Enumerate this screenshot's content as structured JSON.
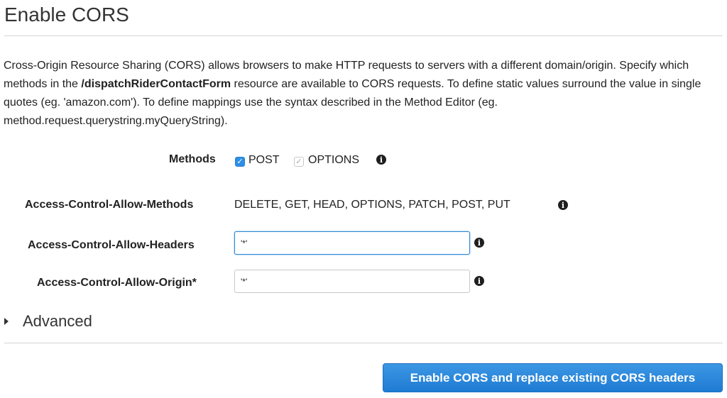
{
  "page": {
    "title": "Enable CORS"
  },
  "description": {
    "part1": "Cross-Origin Resource Sharing (CORS) allows browsers to make HTTP requests to servers with a different domain/origin. Specify which methods in the ",
    "resource": "/dispatchRiderContactForm",
    "part2": " resource are available to CORS requests. To define static values surround the value in single quotes (eg. 'amazon.com'). To define mappings use the syntax described in the Method Editor (eg. method.request.querystring.myQueryString)."
  },
  "methods": {
    "label": "Methods",
    "options": [
      {
        "label": "POST",
        "checked": true,
        "disabled": false
      },
      {
        "label": "OPTIONS",
        "checked": true,
        "disabled": true
      }
    ],
    "info_icon": "info-icon"
  },
  "allow_methods": {
    "label": "Access-Control-Allow-Methods",
    "value": "DELETE, GET, HEAD, OPTIONS, PATCH, POST, PUT",
    "info_icon": "info-icon"
  },
  "allow_headers": {
    "label": "Access-Control-Allow-Headers",
    "value": "'*'",
    "focused": true,
    "info_icon": "info-icon"
  },
  "allow_origin": {
    "label": "Access-Control-Allow-Origin*",
    "value": "'*'",
    "info_icon": "info-icon"
  },
  "advanced": {
    "label": "Advanced",
    "expanded": false,
    "icon": "caret-right-icon"
  },
  "submit": {
    "label": "Enable CORS and replace existing CORS headers"
  },
  "colors": {
    "primary": "#1f7bd3",
    "focus": "#2b87d6",
    "checkbox": "#2d8fe5"
  }
}
